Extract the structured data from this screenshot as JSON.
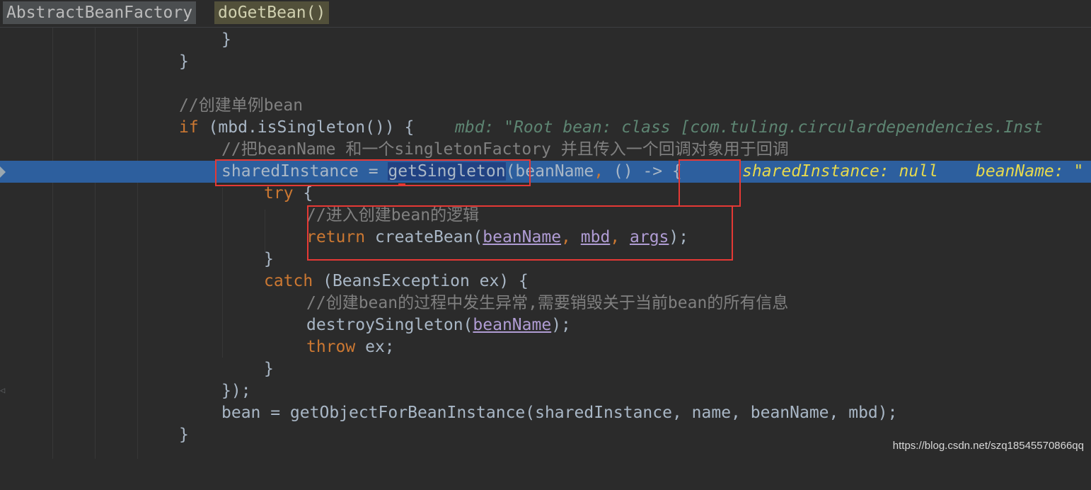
{
  "breadcrumb": {
    "class_name": "AbstractBeanFactory",
    "method_name": "doGetBean()"
  },
  "code": {
    "l1_brace": "}",
    "l2_brace": "}",
    "l4_comment": "//创建单例bean",
    "l5_if": "if",
    "l5_rest": " (mbd.isSingleton()) {",
    "l5_hint": "mbd: \"Root bean: class [com.tuling.circulardependencies.Inst",
    "l6_comment": "//把beanName 和一个singletonFactory 并且传入一个回调对象用于回调",
    "l7_var": "sharedInstance = ",
    "l7_call": "getSingleton",
    "l7_args1": "(beanName",
    "l7_comma": ", ",
    "l7_args2": "() -> {",
    "l7_hint1": "sharedInstance: null",
    "l7_hint2": "beanName: \"",
    "l8_try": "try",
    "l8_brace": " {",
    "l9_comment": "//进入创建bean的逻辑",
    "l10_return": "return",
    "l10_call": " createBean(",
    "l10_p1": "beanName",
    "l10_p2": "mbd",
    "l10_p3": "args",
    "l10_end": ");",
    "l11_brace": "}",
    "l12_catch": "catch",
    "l12_rest": " (BeansException ex) {",
    "l13_comment": "//创建bean的过程中发生异常,需要销毁关于当前bean的所有信息",
    "l14_call": "destroySingleton(",
    "l14_p1": "beanName",
    "l14_end": ");",
    "l15_throw": "throw",
    "l15_rest": " ex;",
    "l16_brace": "}",
    "l17_close": "});",
    "l18_code": "bean = getObjectForBeanInstance(sharedInstance, name, beanName, mbd);",
    "l19_brace": "}"
  },
  "watermark": "https://blog.csdn.net/szq18545570866qq",
  "colors": {
    "background": "#2b2b2b",
    "keyword": "#cc7832",
    "comment": "#808080",
    "current_line": "#2d5f9e",
    "annotation_box": "#e53935"
  }
}
